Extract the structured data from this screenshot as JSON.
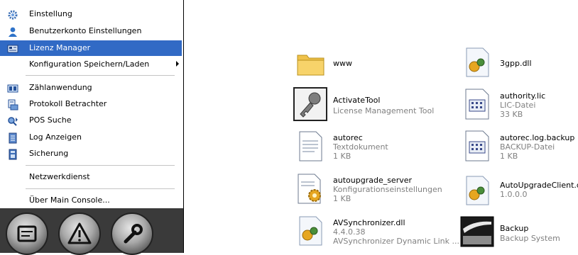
{
  "menu": {
    "items": [
      {
        "label": "Einstellung",
        "icon": "gear-icon"
      },
      {
        "label": "Benutzerkonto Einstellungen",
        "icon": "user-icon"
      },
      {
        "label": "Lizenz Manager",
        "icon": "license-icon"
      },
      {
        "label": "Konfiguration Speichern/Laden",
        "icon": "none"
      },
      {
        "label": "Zählanwendung",
        "icon": "counter-icon"
      },
      {
        "label": "Protokoll Betrachter",
        "icon": "protocol-icon"
      },
      {
        "label": "POS Suche",
        "icon": "search-icon"
      },
      {
        "label": "Log Anzeigen",
        "icon": "log-icon"
      },
      {
        "label": "Sicherung",
        "icon": "backup-icon"
      },
      {
        "label": "Netzwerkdienst",
        "icon": "none"
      },
      {
        "label": "Über Main Console...",
        "icon": "none"
      }
    ],
    "selected_color": "#316ac5"
  },
  "taskbar": {
    "buttons": [
      "console-icon",
      "warning-icon",
      "wrench-icon"
    ]
  },
  "files": [
    {
      "name": "www",
      "line2": "",
      "line3": "",
      "icon": "folder-icon"
    },
    {
      "name": "3gpp.dll",
      "line2": "",
      "line3": "",
      "icon": "dll-icon"
    },
    {
      "name": "ActivateTool",
      "line2": "License Management Tool",
      "line3": "",
      "icon": "key-icon"
    },
    {
      "name": "authority.lic",
      "line2": "LIC-Datei",
      "line3": "33 KB",
      "icon": "generic-file-icon"
    },
    {
      "name": "autorec",
      "line2": "Textdokument",
      "line3": "1 KB",
      "icon": "text-file-icon"
    },
    {
      "name": "autorec.log.backup",
      "line2": "BACKUP-Datei",
      "line3": "1 KB",
      "icon": "generic-file-icon"
    },
    {
      "name": "autoupgrade_server",
      "line2": "Konfigurationseinstellungen",
      "line3": "1 KB",
      "icon": "config-file-icon"
    },
    {
      "name": "AutoUpgradeClient.dll",
      "line2": "1.0.0.0",
      "line3": "",
      "icon": "dll-icon"
    },
    {
      "name": "AVSynchronizer.dll",
      "line2": "4.4.0.38",
      "line3": "AVSynchronizer Dynamic Link ...",
      "icon": "dll-icon"
    },
    {
      "name": "Backup",
      "line2": "Backup System",
      "line3": "",
      "icon": "backup-app-icon"
    }
  ]
}
